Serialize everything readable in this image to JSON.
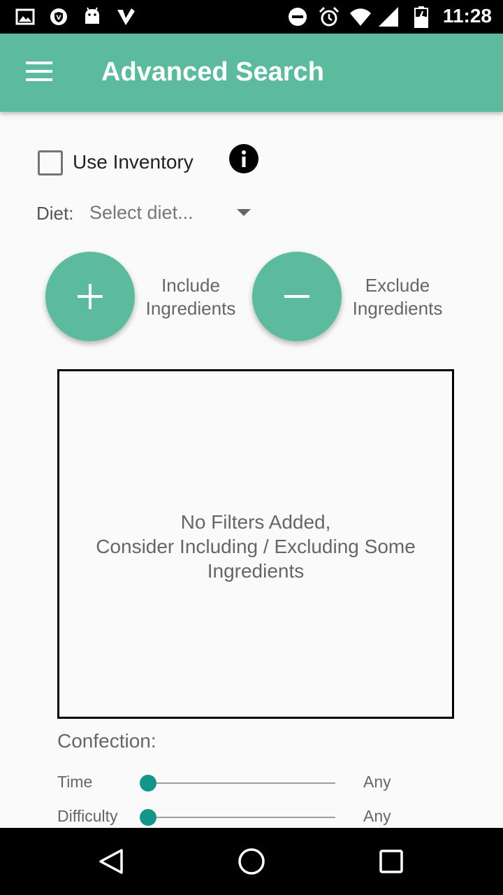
{
  "status_bar": {
    "time": "11:28",
    "left_icons": [
      "image-icon",
      "shield-icon",
      "android-icon",
      "check-icon"
    ],
    "right_icons": [
      "do-not-disturb-icon",
      "alarm-icon",
      "wifi-icon",
      "signal-icon",
      "battery-icon"
    ]
  },
  "app_bar": {
    "title": "Advanced Search",
    "background_color": "#5bbb9c"
  },
  "inventory": {
    "label": "Use Inventory",
    "checked": false
  },
  "diet": {
    "label": "Diet:",
    "selected": "Select diet..."
  },
  "actions": {
    "include_label": "Include\nIngredients",
    "exclude_label": "Exclude\nIngredients"
  },
  "filters": {
    "empty_message": "No Filters Added,\nConsider Including / Excluding Some\nIngredients"
  },
  "confection": {
    "label": "Confection:",
    "sliders": [
      {
        "label": "Time",
        "value": "Any",
        "level": 0
      },
      {
        "label": "Difficulty",
        "value": "Any",
        "level": 0
      }
    ]
  },
  "colors": {
    "accent": "#5bbb9c",
    "slider_thumb": "#129688"
  }
}
